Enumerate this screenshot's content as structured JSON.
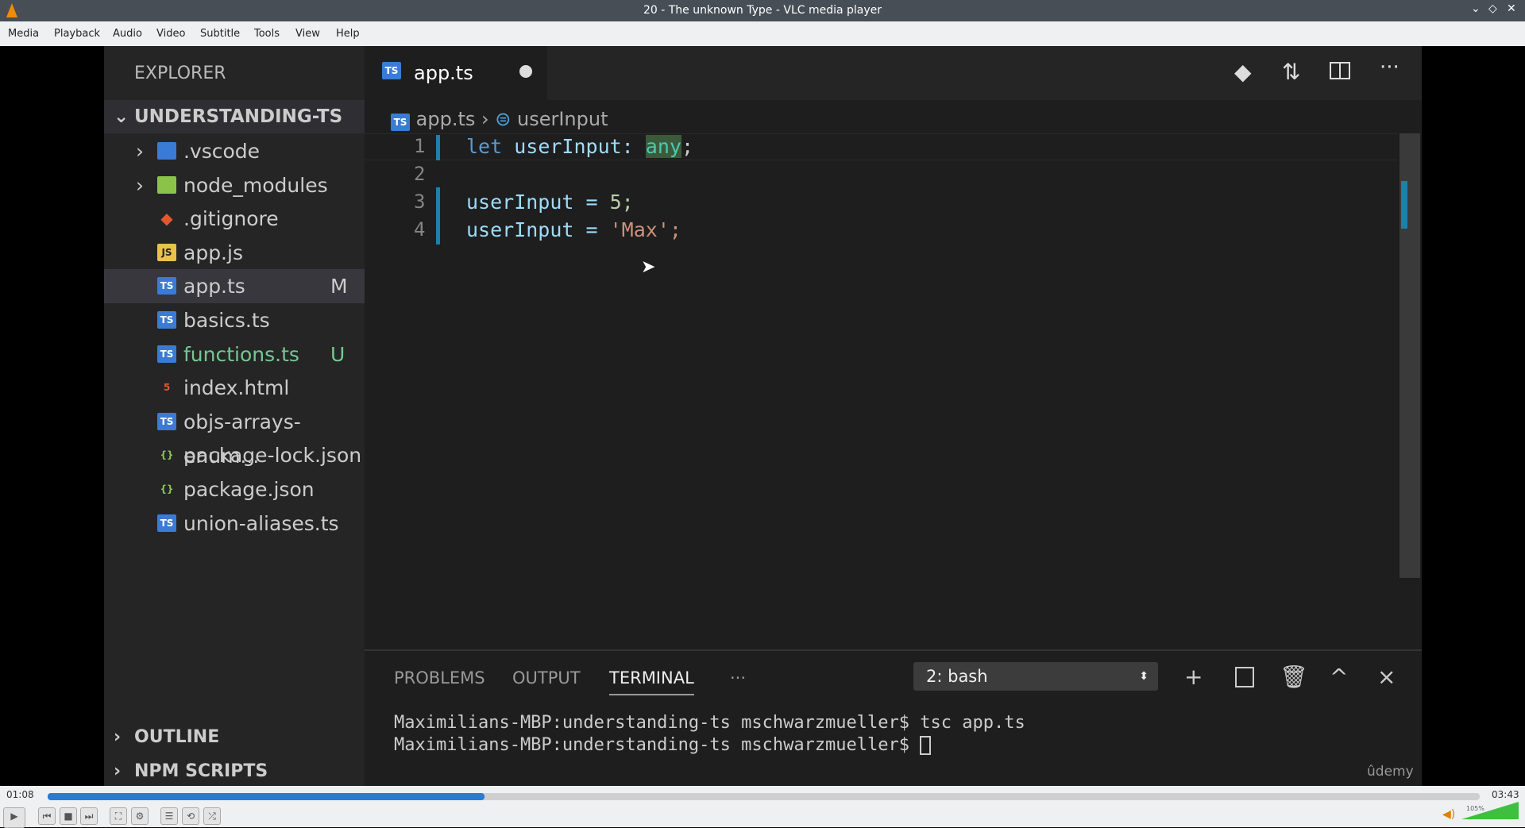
{
  "window": {
    "title": "20 - The unknown Type - VLC media player"
  },
  "menu": [
    "Media",
    "Playback",
    "Audio",
    "Video",
    "Subtitle",
    "Tools",
    "View",
    "Help"
  ],
  "explorer": {
    "header": "EXPLORER",
    "project": "UNDERSTANDING-TS",
    "items": [
      {
        "name": ".vscode",
        "type": "folder",
        "badge": ""
      },
      {
        "name": "node_modules",
        "type": "folder",
        "badge": ""
      },
      {
        "name": ".gitignore",
        "type": "git",
        "badge": ""
      },
      {
        "name": "app.js",
        "type": "js",
        "badge": ""
      },
      {
        "name": "app.ts",
        "type": "ts",
        "badge": "M"
      },
      {
        "name": "basics.ts",
        "type": "ts",
        "badge": ""
      },
      {
        "name": "functions.ts",
        "type": "ts",
        "badge": "U"
      },
      {
        "name": "index.html",
        "type": "html",
        "badge": ""
      },
      {
        "name": "objs-arrays-enum...",
        "type": "ts",
        "badge": ""
      },
      {
        "name": "package-lock.json",
        "type": "json",
        "badge": ""
      },
      {
        "name": "package.json",
        "type": "json",
        "badge": ""
      },
      {
        "name": "union-aliases.ts",
        "type": "ts",
        "badge": ""
      }
    ],
    "outline": "OUTLINE",
    "npm": "NPM SCRIPTS"
  },
  "editor": {
    "tab": "app.ts",
    "breadcrumb": [
      "app.ts",
      "userInput"
    ],
    "lines": [
      {
        "n": "1",
        "kw": "let ",
        "id": "userInput: ",
        "type": "any",
        "rest": ";"
      },
      {
        "n": "2",
        "kw": "",
        "id": "",
        "type": "",
        "rest": ""
      },
      {
        "n": "3",
        "kw": "",
        "id": "userInput = ",
        "type": "",
        "rest": "5;"
      },
      {
        "n": "4",
        "kw": "",
        "id": "userInput = ",
        "type": "",
        "rest": "'Max';"
      }
    ]
  },
  "panel": {
    "tabs": [
      "PROBLEMS",
      "OUTPUT",
      "TERMINAL",
      "···"
    ],
    "shell": "2: bash",
    "lines": [
      "Maximilians-MBP:understanding-ts mschwarzmueller$ tsc app.ts",
      "Maximilians-MBP:understanding-ts mschwarzmueller$ "
    ],
    "watermark": "ûdemy"
  },
  "player": {
    "elapsed": "01:08",
    "total": "03:43",
    "progress": 0.305,
    "volume": "105%",
    "volume_level": 1.05
  }
}
